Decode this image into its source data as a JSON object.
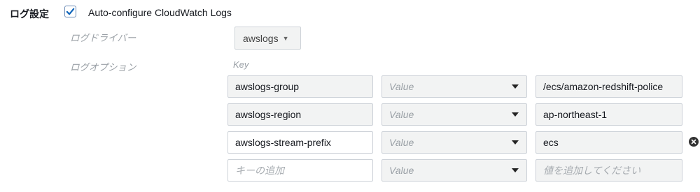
{
  "section": {
    "label": "ログ設定",
    "auto_configure": {
      "checked": true,
      "label": "Auto-configure CloudWatch Logs"
    }
  },
  "log_driver": {
    "label": "ログドライバー",
    "value": "awslogs"
  },
  "log_options": {
    "label": "ログオプション",
    "key_header": "Key",
    "rows": [
      {
        "key": "awslogs-group",
        "value_type": "Value",
        "value": "/ecs/amazon-redshift-police"
      },
      {
        "key": "awslogs-region",
        "value_type": "Value",
        "value": "ap-northeast-1"
      },
      {
        "key": "awslogs-stream-prefix",
        "value_type": "Value",
        "value": "ecs"
      }
    ],
    "new_row": {
      "key_placeholder": "キーの追加",
      "value_type": "Value",
      "value_placeholder": "値を追加してください"
    }
  },
  "icons": {
    "checkbox": "check-icon",
    "dropdown": "caret-down-icon",
    "remove": "remove-circle-icon"
  }
}
